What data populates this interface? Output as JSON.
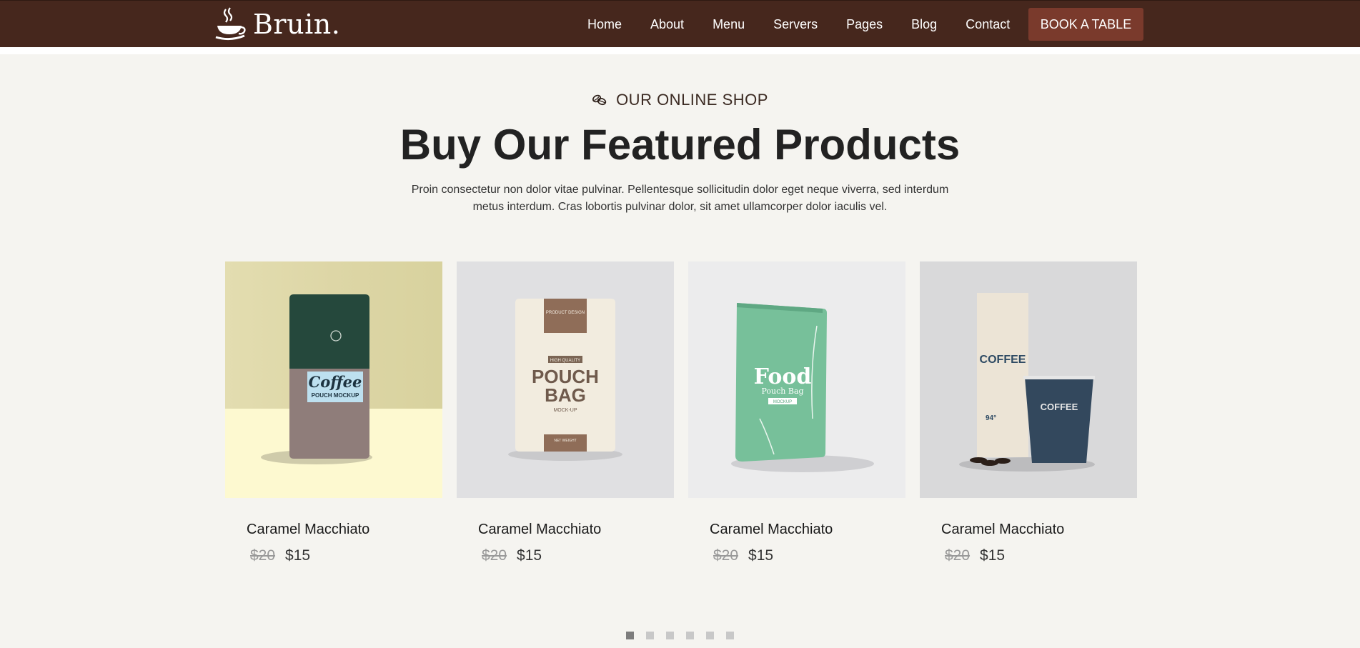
{
  "brand": {
    "name": "Bruin."
  },
  "nav": {
    "items": [
      {
        "label": "Home"
      },
      {
        "label": "About"
      },
      {
        "label": "Menu"
      },
      {
        "label": "Servers"
      },
      {
        "label": "Pages"
      },
      {
        "label": "Blog"
      },
      {
        "label": "Contact"
      }
    ],
    "cta_label": "BOOK A TABLE"
  },
  "section": {
    "eyebrow": "OUR ONLINE SHOP",
    "title": "Buy Our Featured Products",
    "description": "Proin consectetur non dolor vitae pulvinar. Pellentesque sollicitudin dolor eget neque viverra, sed interdum metus interdum. Cras lobortis pulvinar dolor, sit amet ullamcorper dolor iaculis vel."
  },
  "products": [
    {
      "title": "Caramel Macchiato",
      "old_price": "$20",
      "price": "$15",
      "package": {
        "line1": "Coffee",
        "line2": "POUCH MOCKUP"
      }
    },
    {
      "title": "Caramel Macchiato",
      "old_price": "$20",
      "price": "$15",
      "package": {
        "top": "PRODUCT DESIGN",
        "tag": "HIGH QUALITY",
        "line1": "POUCH",
        "line2": "BAG",
        "line3": "MOCK-UP",
        "weight": "NET WEIGHT"
      }
    },
    {
      "title": "Caramel Macchiato",
      "old_price": "$20",
      "price": "$15",
      "package": {
        "line1": "Food",
        "line2": "Pouch Bag",
        "tag": "MOCKUP"
      }
    },
    {
      "title": "Caramel Macchiato",
      "old_price": "$20",
      "price": "$15",
      "package": {
        "bag_label": "COFFEE",
        "cup_label": "COFFEE",
        "number": "94°"
      }
    }
  ],
  "pagination": {
    "count": 6,
    "active_index": 0
  },
  "colors": {
    "nav_bg": "#46271d",
    "cta_bg": "#7a3a2c",
    "page_bg": "#f5f4f0"
  }
}
